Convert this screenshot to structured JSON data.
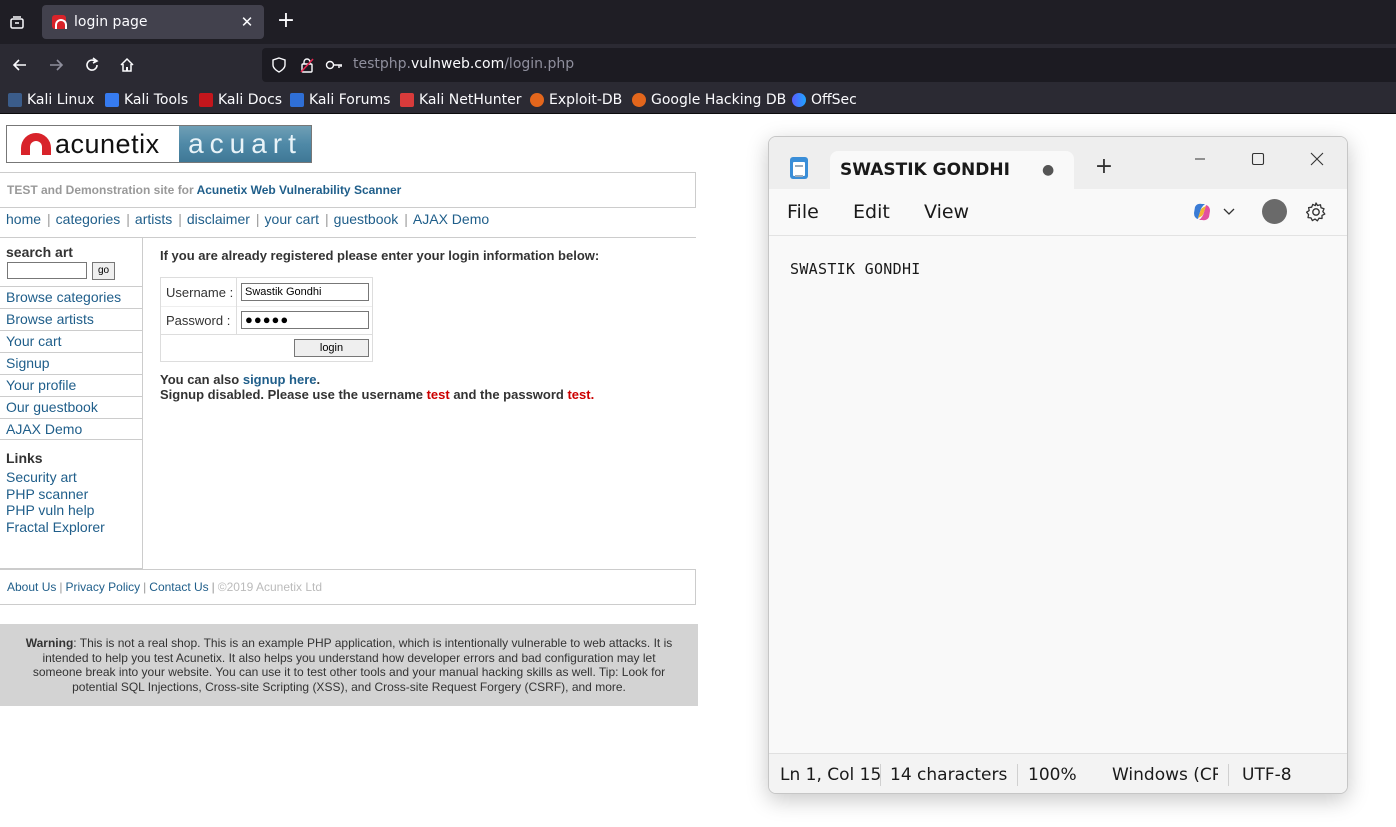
{
  "browser": {
    "tab_title": "login page",
    "url_prefix": "testphp.",
    "url_domain": "vulnweb.com",
    "url_path": "/login.php",
    "bookmarks": [
      "Kali Linux",
      "Kali Tools",
      "Kali Docs",
      "Kali Forums",
      "Kali NetHunter",
      "Exploit-DB",
      "Google Hacking DB",
      "OffSec"
    ]
  },
  "site": {
    "logo_left": "acunetix",
    "logo_right": "acuart",
    "tagline_prefix": "TEST and Demonstration site for ",
    "tagline_link": "Acunetix Web Vulnerability Scanner",
    "topnav": [
      "home",
      "categories",
      "artists",
      "disclaimer",
      "your cart",
      "guestbook",
      "AJAX Demo"
    ],
    "search_title": "search art",
    "search_button": "go",
    "side_links": [
      "Browse categories",
      "Browse artists",
      "Your cart",
      "Signup",
      "Your profile",
      "Our guestbook",
      "AJAX Demo"
    ],
    "links_title": "Links",
    "links": [
      "Security art",
      "PHP scanner",
      "PHP vuln help",
      "Fractal Explorer"
    ],
    "login_intro": "If you are already registered please enter your login information below:",
    "username_label": "Username :",
    "username_value": "Swastik Gondhi",
    "password_label": "Password :",
    "password_value": "●●●●●",
    "login_button": "login",
    "also_prefix": "You can also ",
    "also_link": "signup here",
    "also_suffix": ".",
    "signup_prefix": "Signup disabled. Please use the username ",
    "signup_user": "test",
    "signup_mid": " and the password ",
    "signup_pass": "test",
    "signup_end": ".",
    "footer_links": [
      "About Us",
      "Privacy Policy",
      "Contact Us"
    ],
    "footer_copy": "©2019 Acunetix Ltd",
    "warning_bold": "Warning",
    "warning_text": ": This is not a real shop. This is an example PHP application, which is intentionally vulnerable to web attacks. It is intended to help you test Acunetix. It also helps you understand how developer errors and bad configuration may let someone break into your website. You can use it to test other tools and your manual hacking skills as well. Tip: Look for potential SQL Injections, Cross-site Scripting (XSS), and Cross-site Request Forgery (CSRF), and more."
  },
  "notepad": {
    "tab_title": "SWASTIK GONDHI",
    "unsaved_dot": "●",
    "menu": [
      "File",
      "Edit",
      "View"
    ],
    "content": "SWASTIK GONDHI",
    "status": {
      "position": "Ln 1, Col 15",
      "chars": "14 characters",
      "zoom": "100%",
      "line_ending": "Windows (CRLF)",
      "encoding": "UTF-8"
    }
  }
}
